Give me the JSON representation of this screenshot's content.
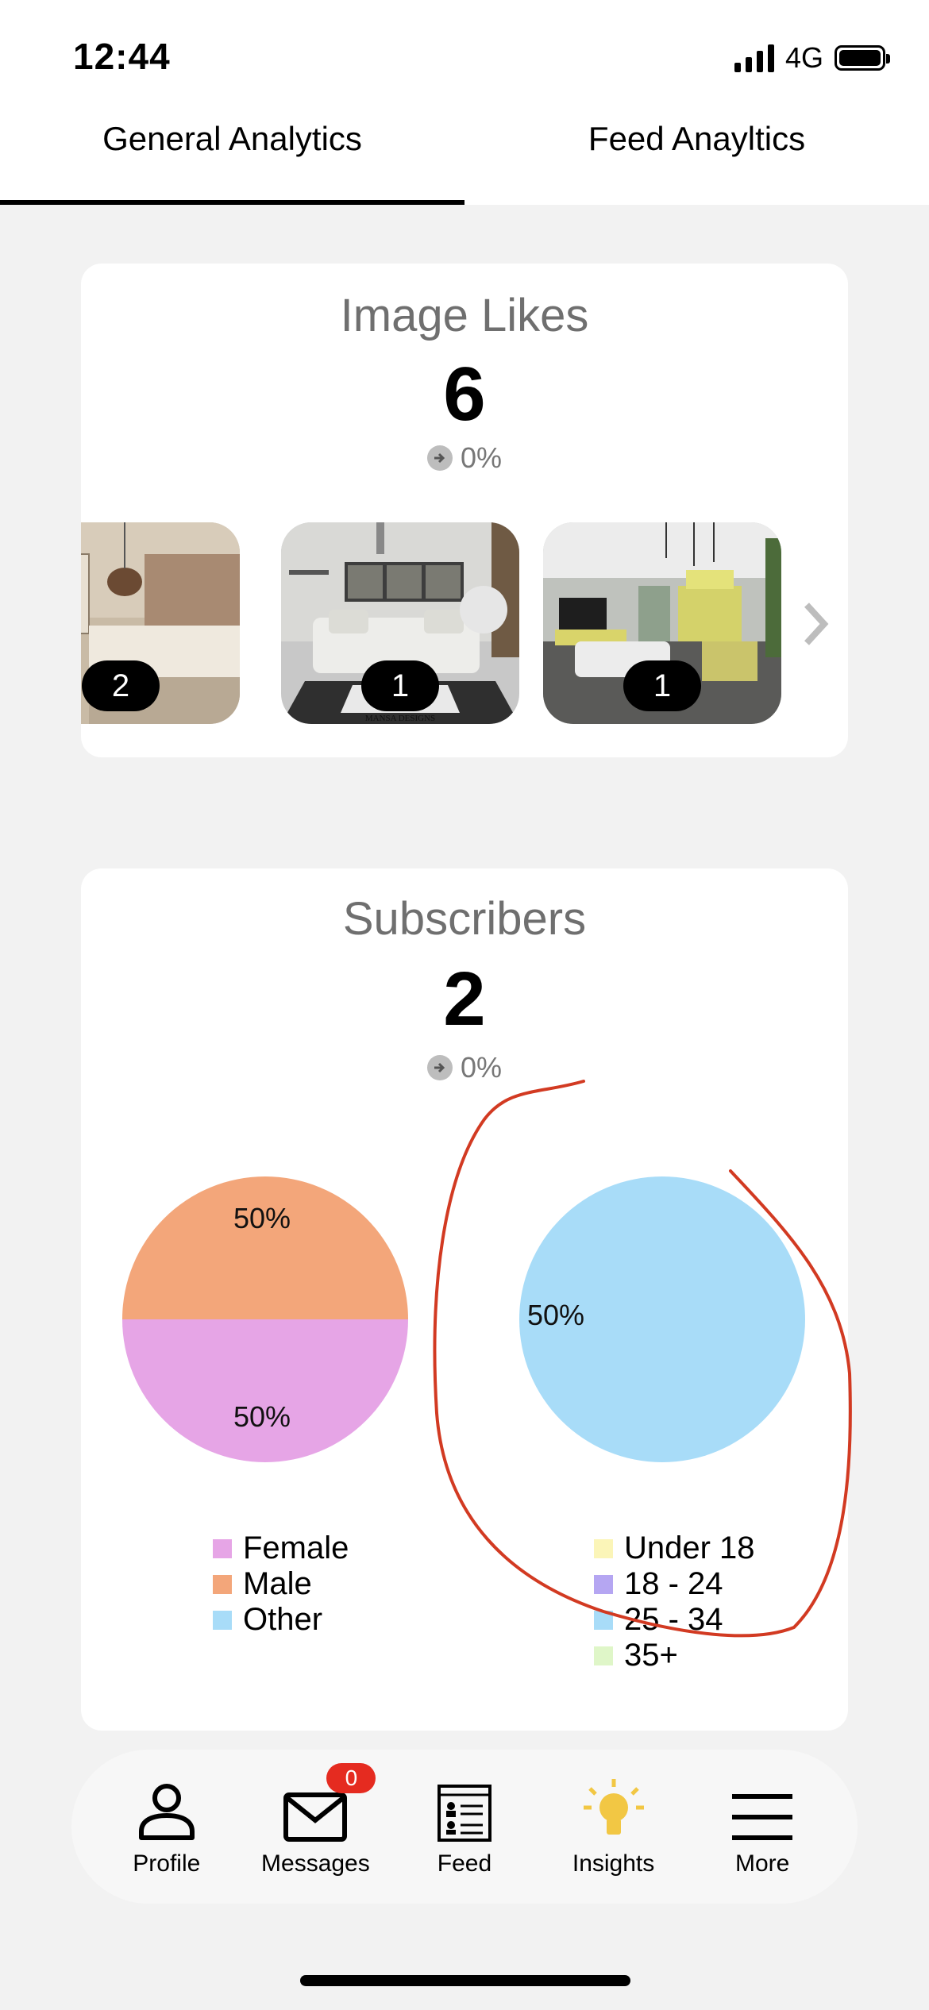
{
  "status_bar": {
    "time": "12:44",
    "network": "4G"
  },
  "tabs": [
    {
      "label": "General Analytics",
      "active": true
    },
    {
      "label": "Feed Anayltics",
      "active": false
    }
  ],
  "image_likes": {
    "title": "Image Likes",
    "value": "6",
    "change": "0%",
    "thumbnails": [
      {
        "count": "2"
      },
      {
        "count": "1",
        "watermark": "MANSA DESIGNS"
      },
      {
        "count": "1"
      }
    ]
  },
  "subscribers": {
    "title": "Subscribers",
    "value": "2",
    "change": "0%",
    "gender_legend": [
      "Female",
      "Male",
      "Other"
    ],
    "age_legend": [
      "Under 18",
      "18 - 24",
      "25 - 34",
      "35+"
    ]
  },
  "chart_data": [
    {
      "type": "pie",
      "categories": [
        "Female",
        "Male",
        "Other"
      ],
      "values": [
        50,
        50,
        0
      ],
      "labels": [
        "50%",
        "50%"
      ],
      "colors": [
        "#e6a5e6",
        "#f3a67a",
        "#a8dcf8"
      ],
      "legend": "bottom"
    },
    {
      "type": "pie",
      "categories": [
        "Under 18",
        "18 - 24",
        "25 - 34",
        "35+"
      ],
      "values": [
        0,
        0,
        100,
        0
      ],
      "labels": [
        "50%"
      ],
      "colors": [
        "#fbf5b8",
        "#b5a6f2",
        "#a8dcf8",
        "#dff6c8"
      ],
      "legend": "bottom"
    }
  ],
  "bottom_nav": [
    {
      "label": "Profile",
      "icon": "person-icon"
    },
    {
      "label": "Messages",
      "icon": "envelope-icon",
      "badge": "0"
    },
    {
      "label": "Feed",
      "icon": "newspaper-icon"
    },
    {
      "label": "Insights",
      "icon": "lightbulb-icon",
      "color": "#f2c744"
    },
    {
      "label": "More",
      "icon": "hamburger-menu-icon"
    }
  ]
}
